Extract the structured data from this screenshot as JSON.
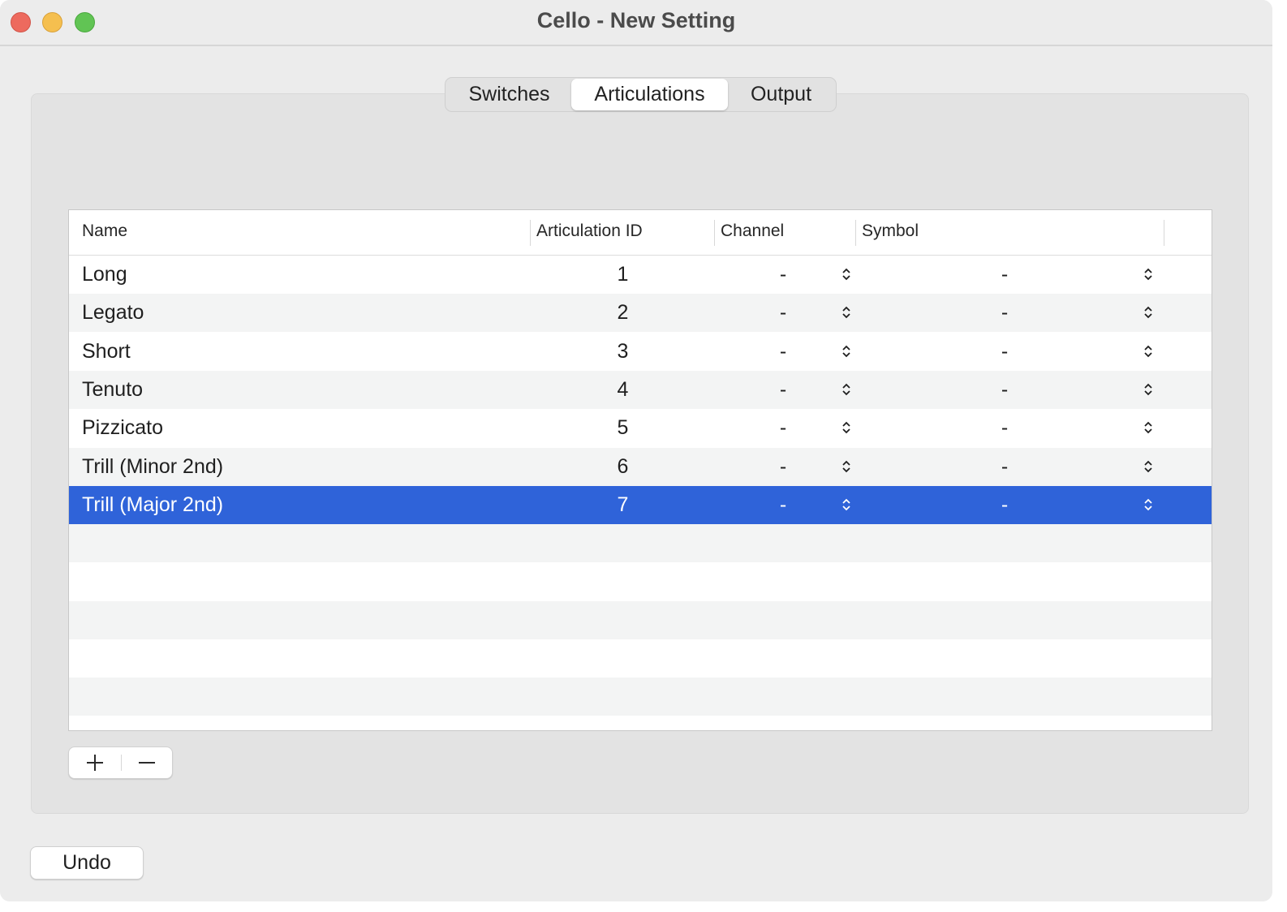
{
  "window": {
    "title": "Cello - New Setting"
  },
  "tabs": [
    {
      "label": "Switches"
    },
    {
      "label": "Articulations",
      "selected": true
    },
    {
      "label": "Output"
    }
  ],
  "table": {
    "columns": [
      "Name",
      "Articulation ID",
      "Channel",
      "Symbol"
    ],
    "rows": [
      {
        "name": "Long",
        "id": "1",
        "channel": "-",
        "symbol": "-"
      },
      {
        "name": "Legato",
        "id": "2",
        "channel": "-",
        "symbol": "-"
      },
      {
        "name": "Short",
        "id": "3",
        "channel": "-",
        "symbol": "-"
      },
      {
        "name": "Tenuto",
        "id": "4",
        "channel": "-",
        "symbol": "-"
      },
      {
        "name": "Pizzicato",
        "id": "5",
        "channel": "-",
        "symbol": "-"
      },
      {
        "name": "Trill (Minor 2nd)",
        "id": "6",
        "channel": "-",
        "symbol": "-"
      },
      {
        "name": "Trill (Major 2nd)",
        "id": "7",
        "channel": "-",
        "symbol": "-",
        "selected": true
      }
    ],
    "selected_row_color": "#2f63d9"
  },
  "footer": {
    "undo_label": "Undo"
  },
  "icons": {
    "close": "close-icon",
    "minimize": "minimize-icon",
    "zoom": "zoom-icon",
    "add": "plus-icon",
    "remove": "minus-icon",
    "stepper": "updown-chevron-icon"
  }
}
